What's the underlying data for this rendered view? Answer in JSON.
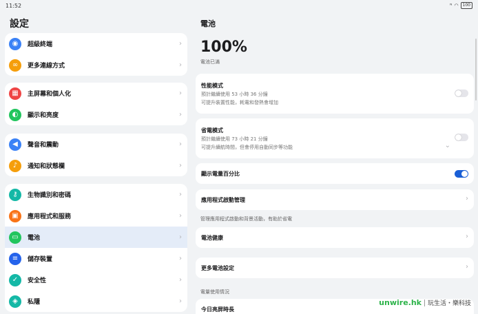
{
  "status": {
    "time": "11:52",
    "battery": "100"
  },
  "left": {
    "title": "設定",
    "groups": [
      {
        "items": [
          {
            "label": "超級終端",
            "color": "#3b82f6",
            "icon": "super-device-icon"
          },
          {
            "label": "更多連線方式",
            "color": "#f59e0b",
            "icon": "link-icon"
          }
        ]
      },
      {
        "items": [
          {
            "label": "主屏幕和個人化",
            "color": "#ef4444",
            "icon": "home-screen-icon"
          },
          {
            "label": "顯示和亮度",
            "color": "#22c55e",
            "icon": "display-icon"
          }
        ]
      },
      {
        "items": [
          {
            "label": "聲音和震動",
            "color": "#3b82f6",
            "icon": "sound-icon"
          },
          {
            "label": "通知和狀態欄",
            "color": "#f59e0b",
            "icon": "bell-icon"
          }
        ]
      },
      {
        "items": [
          {
            "label": "生物識別和密碼",
            "color": "#14b8a6",
            "icon": "key-icon"
          },
          {
            "label": "應用程式和服務",
            "color": "#f97316",
            "icon": "apps-icon"
          },
          {
            "label": "電池",
            "color": "#22c55e",
            "icon": "battery-icon"
          },
          {
            "label": "儲存裝置",
            "color": "#2563eb",
            "icon": "storage-icon"
          },
          {
            "label": "安全性",
            "color": "#14b8a6",
            "icon": "shield-icon"
          },
          {
            "label": "私隱",
            "color": "#14b8a6",
            "icon": "privacy-icon"
          }
        ]
      }
    ]
  },
  "right": {
    "title": "電池",
    "percent": "100%",
    "percent_sub": "電池已滿",
    "performance": {
      "title": "性能模式",
      "line1": "預計繼續使用 53 小時 36 分鐘",
      "line2": "可提升裝置性能，耗電和發熱會增加"
    },
    "power_saving": {
      "title": "省電模式",
      "line1": "預計繼續使用 73 小時 21 分鐘",
      "line2": "可提升續航時間，但會停用自動同步等功能"
    },
    "show_percent": {
      "title": "顯示電量百分比"
    },
    "app_launch": {
      "title": "應用程式啟動管理"
    },
    "app_launch_note": "管理應用程式啟動和背景活動，有助於省電",
    "battery_health": {
      "title": "電池健康"
    },
    "more_settings": {
      "title": "更多電池設定"
    },
    "usage_note": "電量使用情況",
    "screen_time": {
      "title": "今日亮屏時長"
    }
  },
  "watermark": {
    "brand": "unwire.hk",
    "slogan": "玩生活・樂科技"
  },
  "accent": "#1a5fd6"
}
